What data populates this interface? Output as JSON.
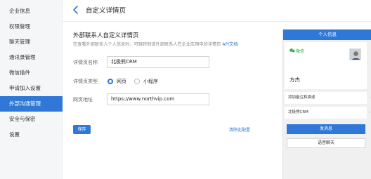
{
  "sidebar": {
    "items": [
      {
        "label": "企业信息",
        "active": false
      },
      {
        "label": "权限管理",
        "active": false
      },
      {
        "label": "聊天管理",
        "active": false
      },
      {
        "label": "通讯录管理",
        "active": false
      },
      {
        "label": "微信插件",
        "active": false
      },
      {
        "label": "申请加入设置",
        "active": false
      },
      {
        "label": "外部沟通管理",
        "active": true
      },
      {
        "label": "安全与保密",
        "active": false
      },
      {
        "label": "设置",
        "active": false
      }
    ]
  },
  "header": {
    "title": "自定义详情页"
  },
  "section": {
    "title": "外部联系人自定义详情页",
    "description": "在查看外部联系人个人信息时，可跳转到该外部联系人在企业应用中的详情页",
    "doc_link": "API文档"
  },
  "form": {
    "name_label": "详情页名称",
    "name_value": "北极熊CRM",
    "type_label": "详情页类型",
    "type_option_web": "网页",
    "type_option_miniprogram": "小程序",
    "type_selected": "网页",
    "url_label": "网页地址",
    "url_value": "https://www.northvip.com",
    "save_button": "保存",
    "clear_link": "清除此配置"
  },
  "preview": {
    "header": "个人信息",
    "wechat_label": "微信",
    "contact_name": "方杰",
    "row_note": "添加备注和描述",
    "row_custom": "北极熊CRM",
    "send_button": "发消息",
    "voice_button": "语音聊天"
  },
  "colors": {
    "accent": "#2f78d8",
    "wechat_green": "#2faa4a",
    "sidebar_bg": "#f5f6f7"
  }
}
